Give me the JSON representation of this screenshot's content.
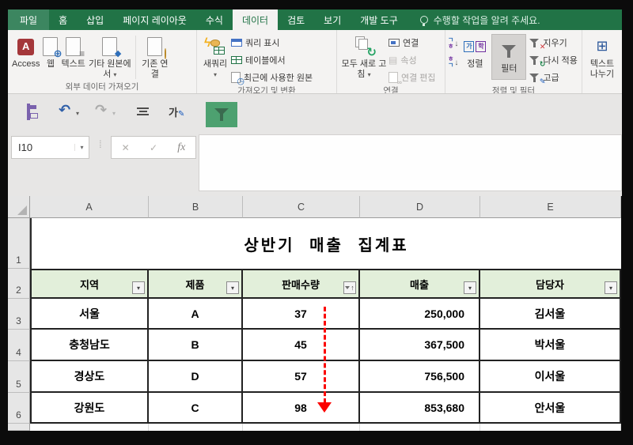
{
  "tabs": {
    "file": "파일",
    "items": [
      "홈",
      "삽입",
      "페이지 레이아웃",
      "수식",
      "데이터",
      "검토",
      "보기",
      "개발 도구"
    ],
    "active": "데이터",
    "tellme": "수행할 작업을 알려 주세요."
  },
  "ribbon": {
    "group_external": {
      "label": "외부 데이터 가져오기",
      "access": "Access",
      "access_initial": "A",
      "web": "웹",
      "text": "텍스트",
      "other": "기타 원본에서",
      "existing": "기존 연결"
    },
    "group_transform": {
      "label": "가져오기 및 변환",
      "new_query": "새쿼리",
      "show_queries": "쿼리 표시",
      "from_table": "테이블에서",
      "recent_sources": "최근에 사용한 원본"
    },
    "group_connections": {
      "label": "연결",
      "refresh_all": "모두 새로 고침",
      "connections": "연결",
      "properties": "속성",
      "edit_links": "연결 편집"
    },
    "group_sort_filter": {
      "label": "정렬 및 필터",
      "sort": "정렬",
      "filter": "필터",
      "clear": "지우기",
      "reapply": "다시 적용",
      "advanced": "고급"
    },
    "group_text": {
      "text_to_columns": "텍스트 나누기"
    }
  },
  "formula": {
    "name_box": "I10",
    "fx_label": "fx",
    "value": ""
  },
  "sheet": {
    "columns": [
      "A",
      "B",
      "C",
      "D",
      "E"
    ],
    "row_numbers": [
      "1",
      "2",
      "3",
      "4",
      "5",
      "6"
    ],
    "title": "상반기 매출 집계표",
    "table": {
      "headers": [
        "지역",
        "제품",
        "판매수량",
        "매출",
        "담당자"
      ],
      "sorted_column": "판매수량",
      "sort_direction": "ascending",
      "rows": [
        [
          "서울",
          "A",
          "37",
          "250,000",
          "김서울"
        ],
        [
          "충청남도",
          "B",
          "45",
          "367,500",
          "박서울"
        ],
        [
          "경상도",
          "D",
          "57",
          "756,500",
          "이서울"
        ],
        [
          "강원도",
          "C",
          "98",
          "853,680",
          "안서울"
        ]
      ]
    },
    "overlay": {
      "type": "red-dashed-down-arrow",
      "over_column": "판매수량"
    }
  },
  "icons": {
    "caret": "▾",
    "undo": "↶",
    "redo": "↷",
    "check": "✓",
    "cross": "✕",
    "lightning": "ϟ",
    "refresh": "↻",
    "clock": "◷",
    "globe": "⊕",
    "target": "◆",
    "lines": "≡",
    "props": "▤",
    "link": "∞",
    "pencil": "✎",
    "table_glyph": "⊞",
    "up_arrow": "↑",
    "down_arrow": "↓",
    "jamo_g": "ㄱ",
    "jamo_h": "ㅎ",
    "ga": "가",
    "hak": "학"
  },
  "colors": {
    "ribbon_green": "#217346",
    "table_header_fill": "#e2efda",
    "arrow_red": "#fb0200",
    "qat_filter_green": "#4da170"
  }
}
